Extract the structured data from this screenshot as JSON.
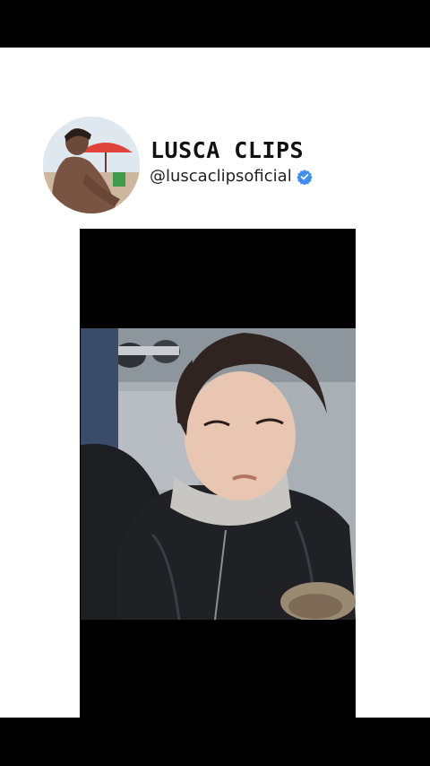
{
  "profile": {
    "channel_name": "LUSCA CLIPS",
    "handle": "@luscaclipsoficial",
    "verified_icon": "verified-badge-icon",
    "avatar_icon": "avatar"
  },
  "video": {
    "thumbnail": "video-frame"
  },
  "colors": {
    "background": "#000000",
    "panel": "#ffffff",
    "verified": "#3d8ff0"
  }
}
